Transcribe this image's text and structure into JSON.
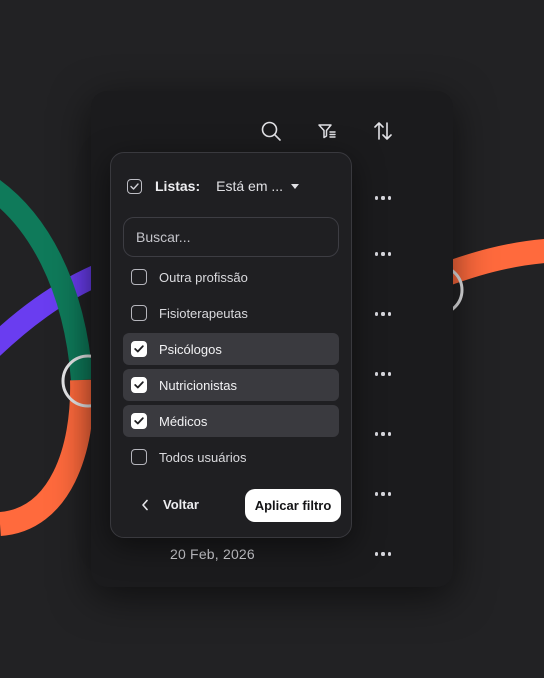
{
  "toolbar": {
    "icons": [
      "search-icon",
      "filter-icon",
      "sort-icon"
    ]
  },
  "table": {
    "visible_date": "20 Feb, 2026",
    "row_action_icon": "more-horizontal-icon"
  },
  "filter_panel": {
    "header_label": "Listas:",
    "operator_value": "Está em ...",
    "search_placeholder": "Buscar...",
    "options": [
      {
        "label": "Outra profissão",
        "checked": false
      },
      {
        "label": "Fisioterapeutas",
        "checked": false
      },
      {
        "label": "Psicólogos",
        "checked": true
      },
      {
        "label": "Nutricionistas",
        "checked": true
      },
      {
        "label": "Médicos",
        "checked": true
      },
      {
        "label": "Todos usuários",
        "checked": false
      }
    ],
    "back_label": "Voltar",
    "apply_label": "Aplicar filtro"
  },
  "colors": {
    "background": "#222224",
    "card": "#1b1b1d",
    "panel": "#1f1f22",
    "accent_green": "#0f7a5a",
    "accent_orange": "#ff6a3d",
    "accent_purple": "#6a3df0",
    "primary_button": "#ffffff"
  }
}
